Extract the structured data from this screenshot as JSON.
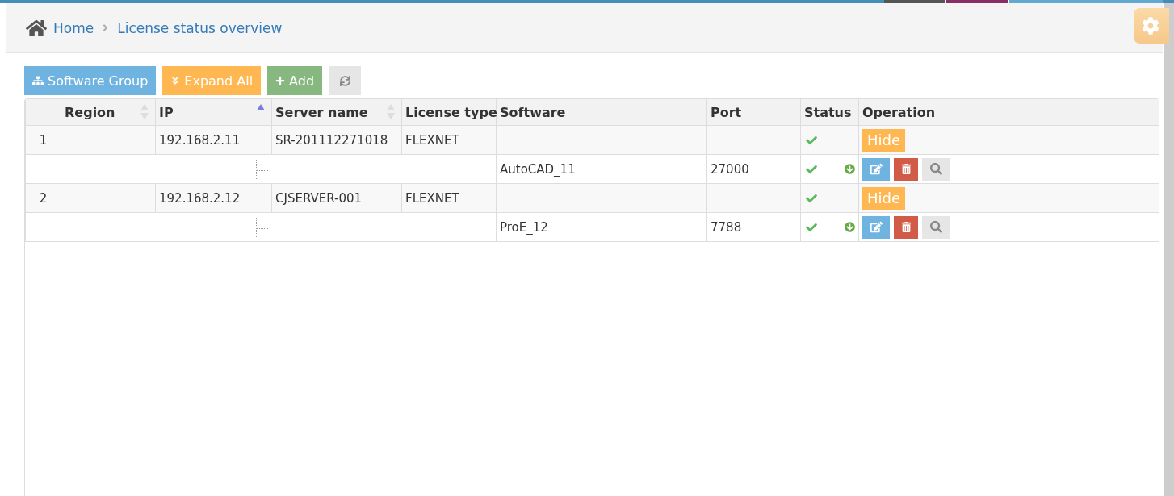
{
  "breadcrumb": {
    "items": [
      {
        "label": "Home"
      },
      {
        "label": "License status overview"
      }
    ]
  },
  "toolbar": [
    {
      "kind": "group",
      "label": "Software Group"
    },
    {
      "kind": "expand",
      "label": "Expand All"
    },
    {
      "kind": "add",
      "label": "Add"
    },
    {
      "kind": "refresh"
    }
  ],
  "table": {
    "columns": [
      {},
      {
        "label": "Region",
        "sortable": true,
        "sorted_ascending": false
      },
      {
        "label": "IP",
        "sortable": true,
        "sorted_ascending": true
      },
      {
        "label": "Server name",
        "sortable": true,
        "sorted_ascending": false
      },
      {
        "label": "License type"
      },
      {
        "label": "Software"
      },
      {
        "label": "Port"
      },
      {
        "label": "Status"
      },
      {
        "label": "Operation"
      }
    ],
    "rows": [
      {
        "kind": "server",
        "index": "1",
        "ip": "192.168.2.11",
        "server_name": "SR-201112271018",
        "license_type": "FLEXNET",
        "status_ok": true,
        "action": "Hide"
      },
      {
        "kind": "software",
        "software": "AutoCAD_11",
        "port": "27000",
        "status_ok": true
      },
      {
        "kind": "server",
        "index": "2",
        "ip": "192.168.2.12",
        "server_name": "CJSERVER-001",
        "license_type": "FLEXNET",
        "status_ok": true,
        "action": "Hide"
      },
      {
        "kind": "software",
        "software": "ProE_12",
        "port": "7788",
        "status_ok": true
      }
    ]
  }
}
